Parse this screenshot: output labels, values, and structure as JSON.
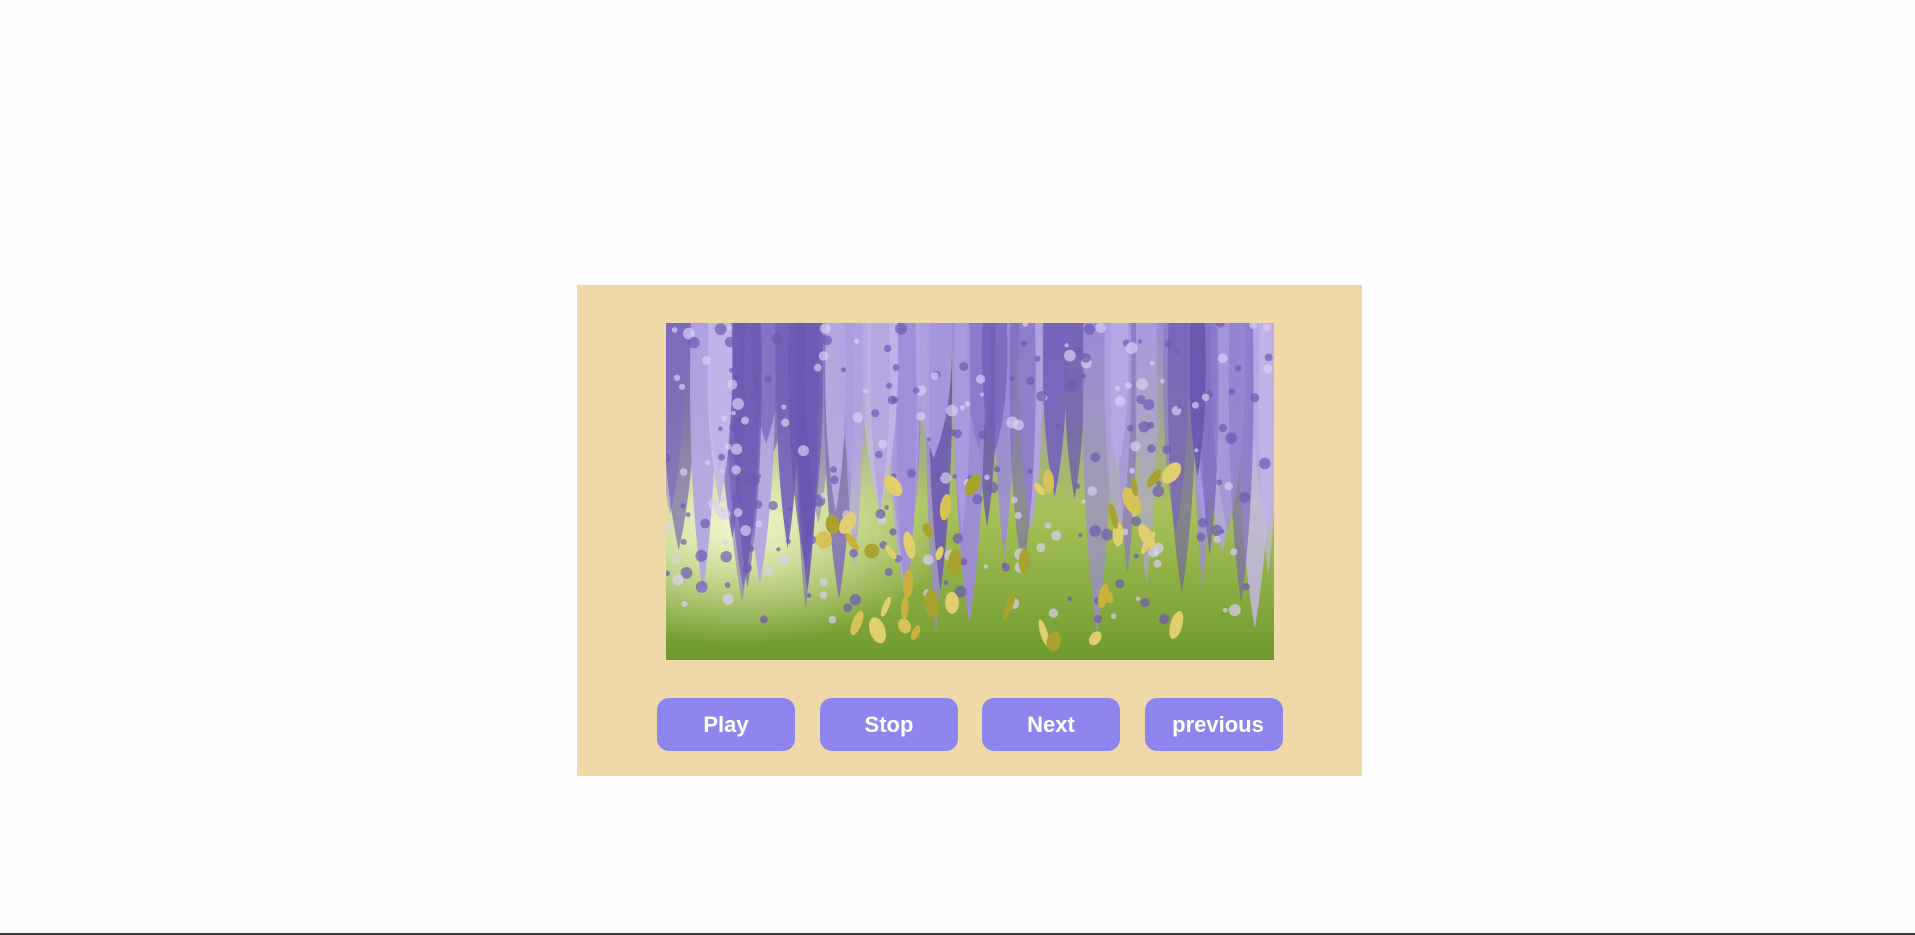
{
  "slideshow": {
    "image": {
      "icon": "wisteria-flowers-photo",
      "colors": {
        "flowers": "#8a76c9",
        "flowers_light": "#c6b8ea",
        "foliage": "#b9c94a",
        "background": "#7ea13a"
      }
    },
    "controls": {
      "play_label": "Play",
      "stop_label": "Stop",
      "next_label": "Next",
      "previous_label": "previous"
    }
  },
  "colors": {
    "panel": "#f0d9a8",
    "button": "#8e86ee",
    "button_text": "#ffffff"
  }
}
